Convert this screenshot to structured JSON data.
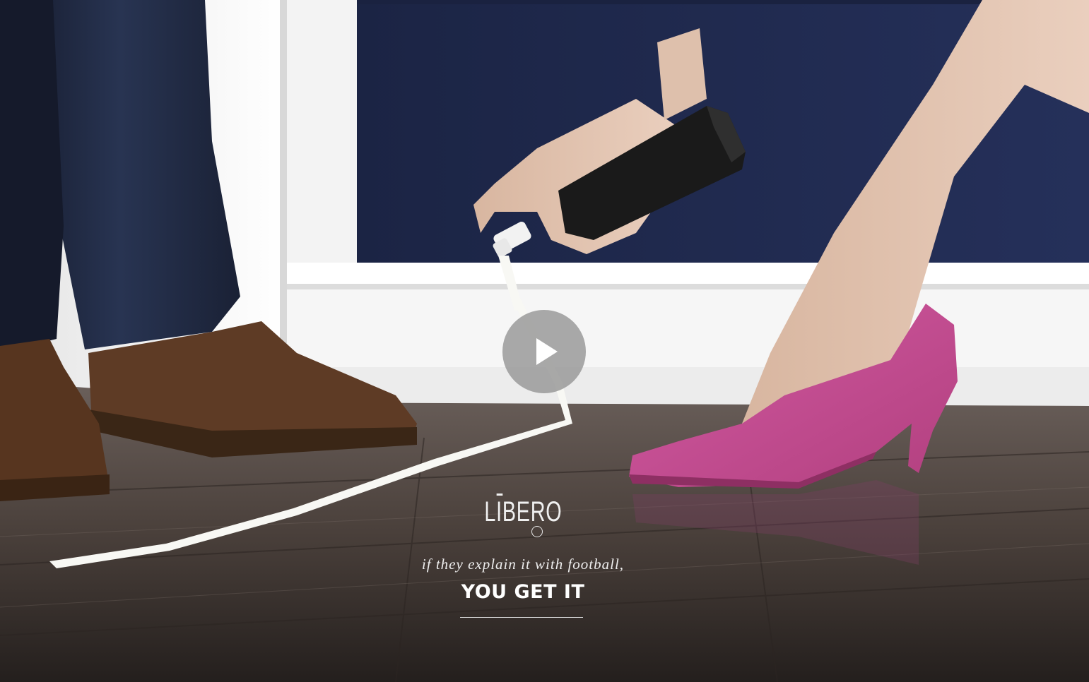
{
  "brand": {
    "logo": "LIBERO",
    "tagline": "if they explain it with football,",
    "cta": "YOU GET IT"
  },
  "video": {
    "play_icon": "play-icon"
  },
  "colors": {
    "wall": "#1f2a4a",
    "door": "#f2f2f2",
    "floor": "#4a3f3a",
    "shoe_pink": "#c84e98",
    "shoe_brown": "#5b3a25",
    "play_bg": "#969696"
  }
}
